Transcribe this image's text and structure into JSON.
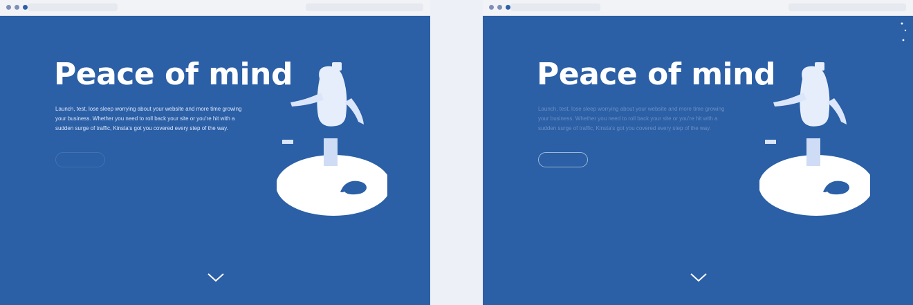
{
  "colors": {
    "hero_background": "#2b5fa6",
    "page_background": "#eef0f8",
    "text": "#ffffff"
  },
  "icons": {
    "scroll": "chevron-down-icon",
    "window_controls": "traffic-light-dots"
  },
  "windows": [
    {
      "variant": "left",
      "hero": {
        "title": "Peace of mind",
        "body": "Launch, test, lose sleep worrying about your website and more time growing your business. Whether you need to roll back your site or you're hit with a sudden surge of traffic, Kinsta's got you covered every step of the way.",
        "cta_label": ""
      }
    },
    {
      "variant": "right",
      "hero": {
        "title": "Peace of mind",
        "body": "Launch, test, lose sleep worrying about your website and more time growing your business. Whether you need to roll back your site or you're hit with a sudden surge of traffic, Kinsta's got you covered every step of the way.",
        "cta_label": ""
      }
    }
  ]
}
